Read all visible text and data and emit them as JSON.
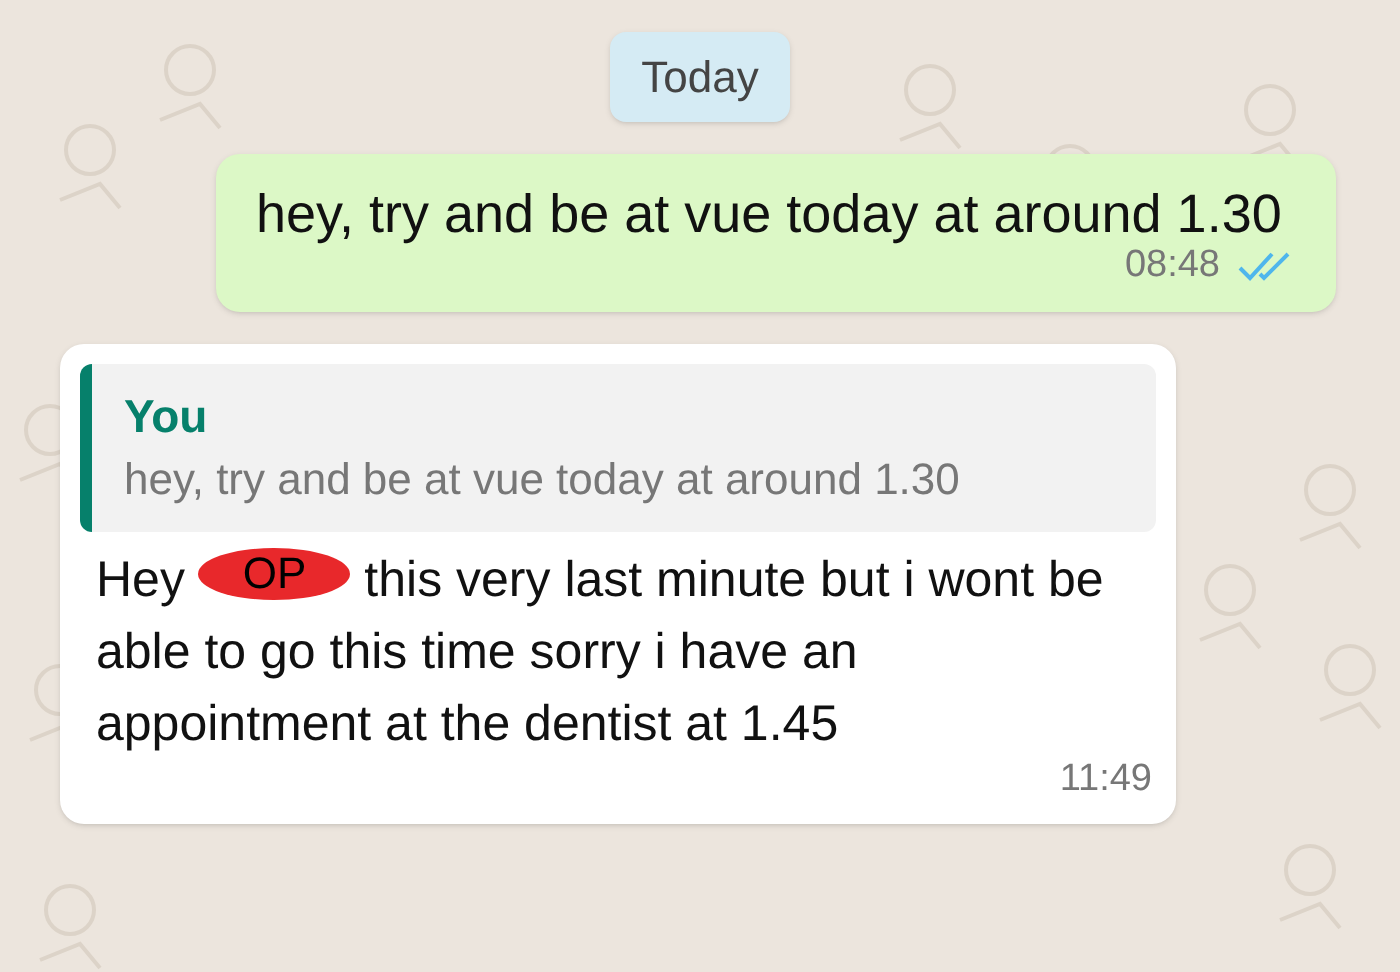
{
  "date_chip": "Today",
  "messages": [
    {
      "kind": "outgoing",
      "text": "hey, try and be at vue today at around 1.30",
      "time": "08:48",
      "read": true
    },
    {
      "kind": "incoming",
      "quote": {
        "author": "You",
        "text": "hey, try and be at vue today at around 1.30"
      },
      "text_before": "Hey",
      "redaction_mark": "OP",
      "text_after": "this very last minute but i wont be able to go this time sorry i have an appointment at the dentist at 1.45",
      "time": "11:49"
    }
  ]
}
